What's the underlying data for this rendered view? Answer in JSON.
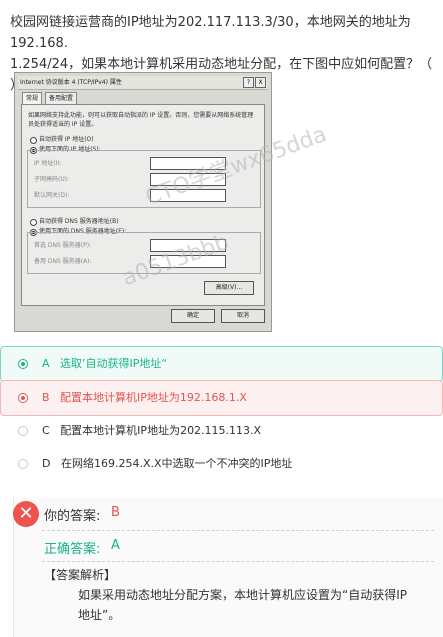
{
  "question": "校园网链接运营商的IP地址为202.117.113.3/30，本地网关的地址为192.168.\n1.254/24，如果本地计算机采用动态地址分配，在下图中应如何配置？（ ）。",
  "dialog": {
    "title": "Internet 协议版本 4 (TCP/IPv4) 属性",
    "help_btn": "?",
    "close_btn": "X",
    "tabs": [
      "常规",
      "备用配置"
    ],
    "desc": "如果网络支持此功能，则可以获取自动指派的 IP 设置。否则，您需要从网络系统管理员处获得适当的 IP 设置。",
    "radio_auto_ip": "自动获得 IP 地址(O)",
    "radio_manual_ip": "使用下面的 IP 地址(S):",
    "ip_label": "IP 地址(I):",
    "mask_label": "子网掩码(U):",
    "gw_label": "默认网关(D):",
    "radio_auto_dns": "自动获得 DNS 服务器地址(B)",
    "radio_manual_dns": "使用下面的 DNS 服务器地址(E):",
    "dns1_label": "首选 DNS 服务器(P):",
    "dns2_label": "备用 DNS 服务器(A):",
    "advanced_btn": "高级(V)...",
    "ok_btn": "确定",
    "cancel_btn": "取消"
  },
  "watermark": [
    "CTO学堂wx65dda",
    "a0513bbb"
  ],
  "options": [
    {
      "letter": "A",
      "text": "选取’自动获得IP地址“",
      "state": "correct"
    },
    {
      "letter": "B",
      "text": "配置本地计算机IP地址为192.168.1.X",
      "state": "wrong"
    },
    {
      "letter": "C",
      "text": "配置本地计算机IP地址为202.115.113.X",
      "state": "plain"
    },
    {
      "letter": "D",
      "text": "在网络169.254.X.X中选取一个不冲突的IP地址",
      "state": "plain"
    }
  ],
  "answer": {
    "your_label": "你的答案:",
    "your_value": "B",
    "correct_label": "正确答案:",
    "correct_value": "A",
    "analysis_title": "【答案解析】",
    "analysis_text": "如果采用动态地址分配方案，本地计算机应设置为“自动获得IP\n地址”。"
  },
  "colors": {
    "correct": "#19b38a",
    "wrong": "#e05555"
  }
}
